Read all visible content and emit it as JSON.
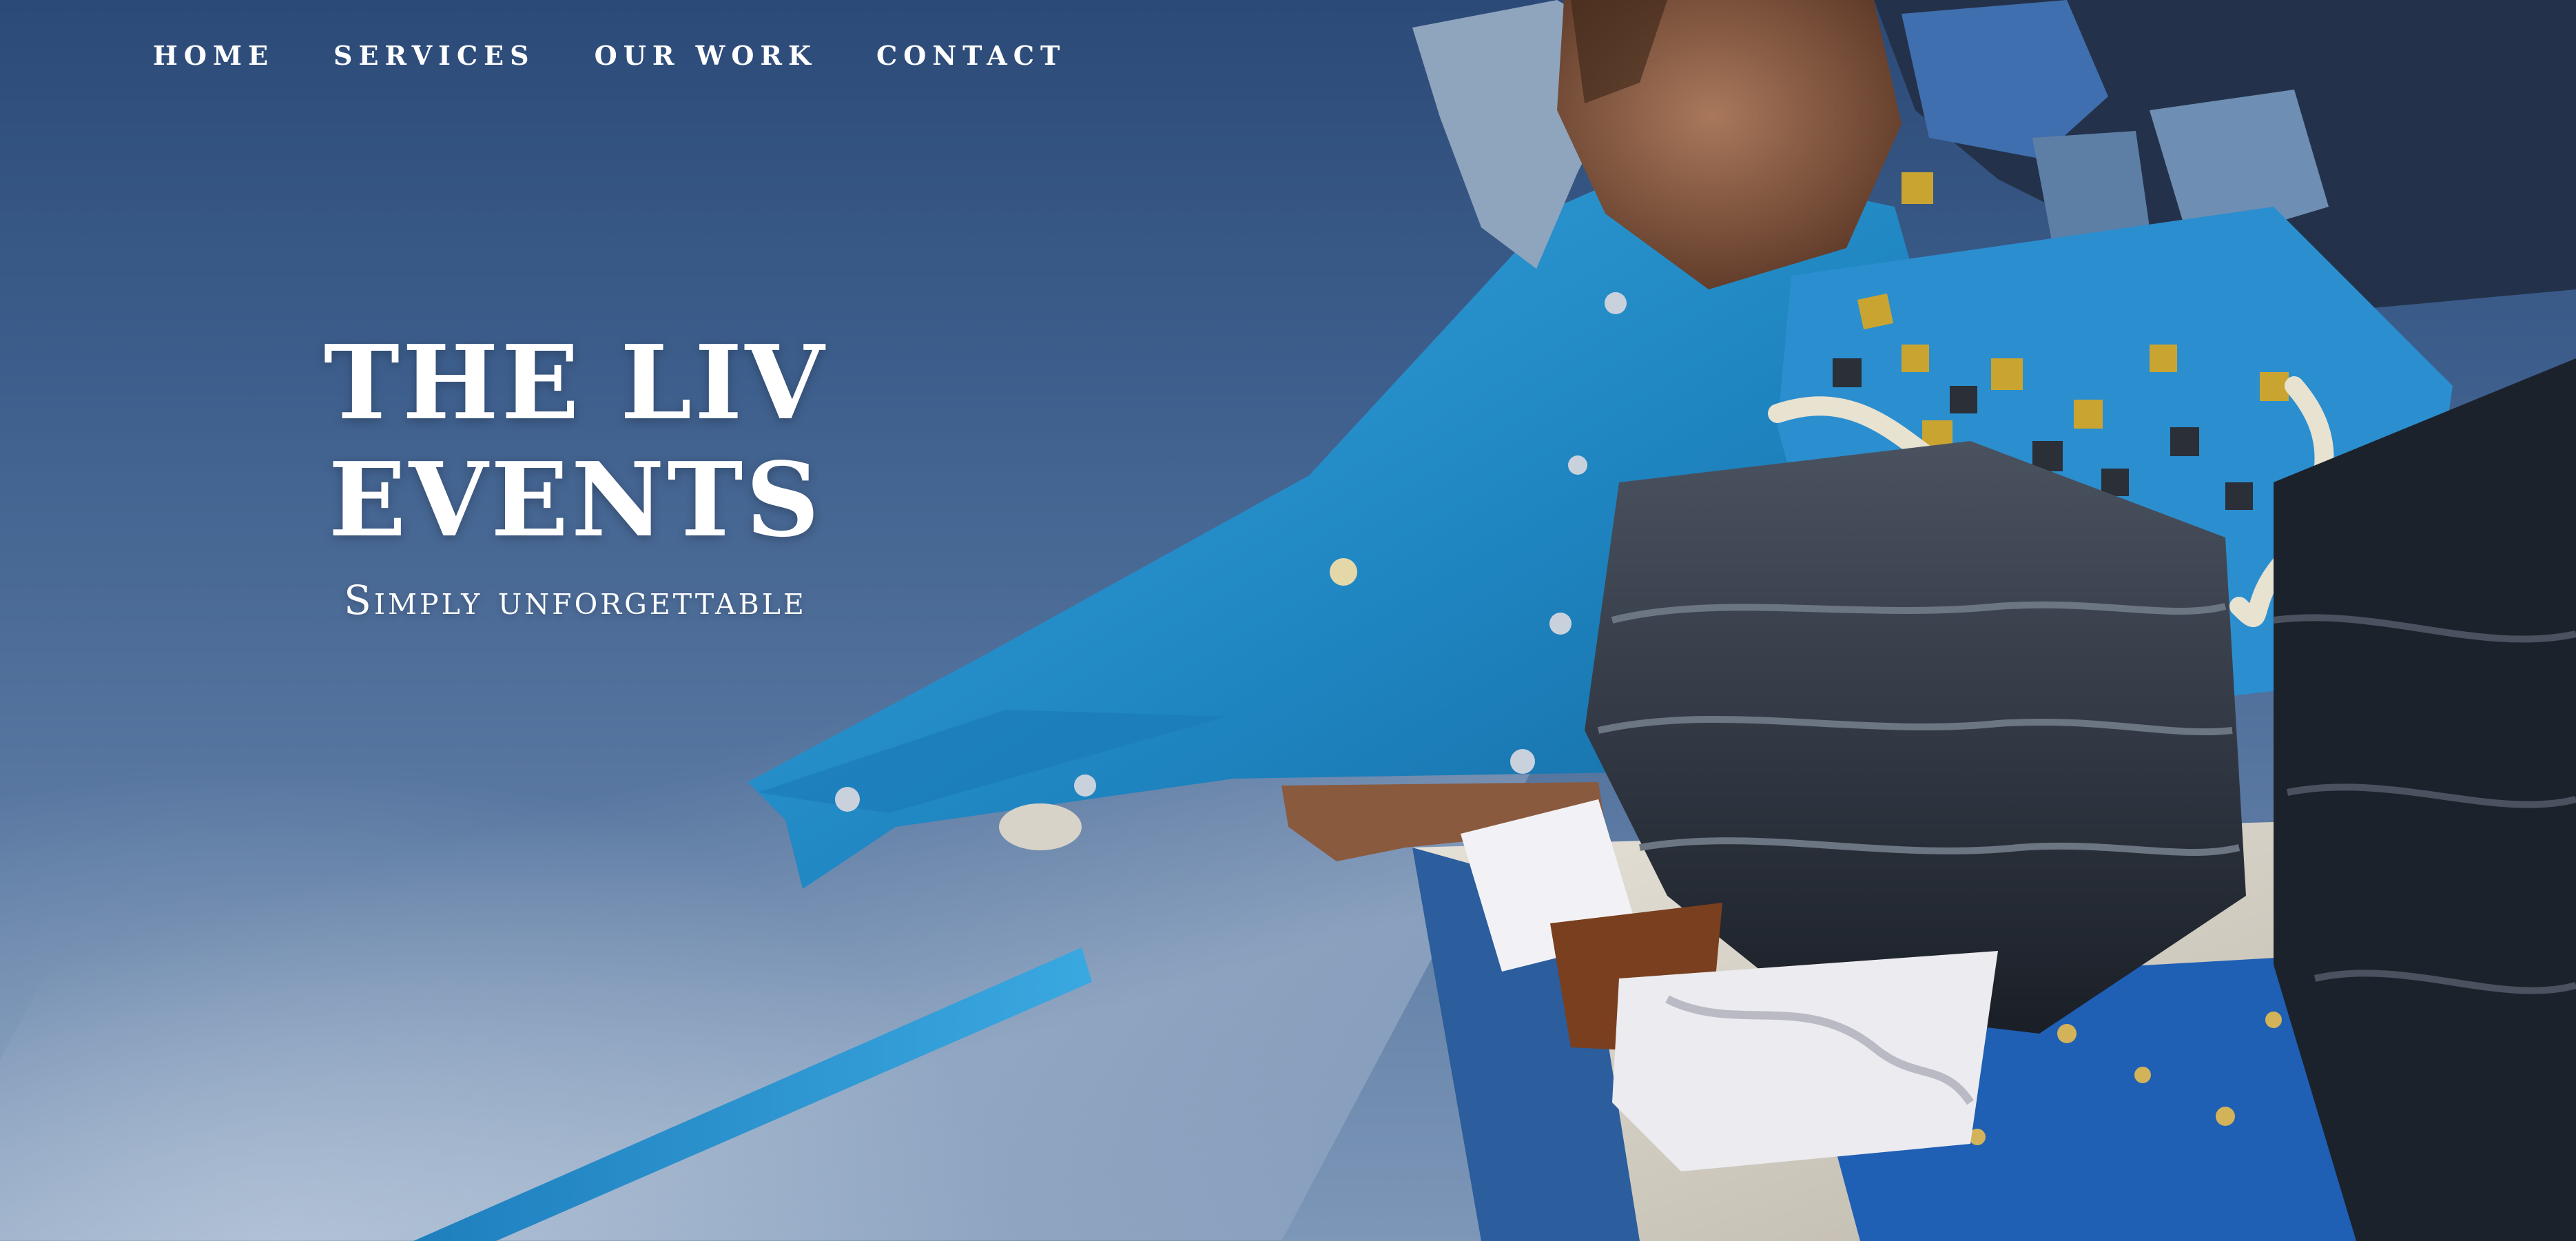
{
  "nav": {
    "items": [
      {
        "label": "HOME"
      },
      {
        "label": "SERVICES"
      },
      {
        "label": "OUR WORK"
      },
      {
        "label": "CONTACT"
      }
    ]
  },
  "hero": {
    "title": "THE LIV EVENTS",
    "subtitle": "Simply unforgettable",
    "image": "carnival-costume-performer-photo"
  },
  "colors": {
    "sky": "#3d5e8c",
    "costume_blue": "#2a8fc8",
    "text": "#ffffff"
  }
}
